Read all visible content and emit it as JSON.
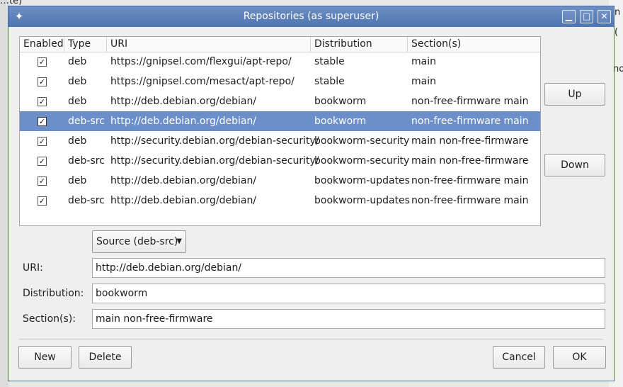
{
  "background": {
    "fragments": [
      "…te)",
      "n",
      "(",
      "no"
    ]
  },
  "titlebar": {
    "title": "Repositories (as superuser)",
    "buttons": [
      "minimize",
      "maximize",
      "close"
    ]
  },
  "table": {
    "columns": [
      "Enabled",
      "Type",
      "URI",
      "Distribution",
      "Section(s)"
    ],
    "selected_index": 3,
    "rows": [
      {
        "enabled": true,
        "type": "deb",
        "uri": "https://gnipsel.com/flexgui/apt-repo/",
        "distribution": "stable",
        "sections": "main"
      },
      {
        "enabled": true,
        "type": "deb",
        "uri": "https://gnipsel.com/mesact/apt-repo/",
        "distribution": "stable",
        "sections": "main"
      },
      {
        "enabled": true,
        "type": "deb",
        "uri": "http://deb.debian.org/debian/",
        "distribution": "bookworm",
        "sections": "non-free-firmware main"
      },
      {
        "enabled": true,
        "type": "deb-src",
        "uri": "http://deb.debian.org/debian/",
        "distribution": "bookworm",
        "sections": "non-free-firmware main"
      },
      {
        "enabled": true,
        "type": "deb",
        "uri": "http://security.debian.org/debian-security/",
        "distribution": "bookworm-security",
        "sections": "main non-free-firmware"
      },
      {
        "enabled": true,
        "type": "deb-src",
        "uri": "http://security.debian.org/debian-security/",
        "distribution": "bookworm-security",
        "sections": "main non-free-firmware"
      },
      {
        "enabled": true,
        "type": "deb",
        "uri": "http://deb.debian.org/debian/",
        "distribution": "bookworm-updates",
        "sections": "non-free-firmware main"
      },
      {
        "enabled": true,
        "type": "deb-src",
        "uri": "http://deb.debian.org/debian/",
        "distribution": "bookworm-updates",
        "sections": "non-free-firmware main"
      }
    ]
  },
  "side_buttons": {
    "up": "Up",
    "down": "Down"
  },
  "editor": {
    "source_type": "Source (deb-src)",
    "uri_label": "URI:",
    "uri_value": "http://deb.debian.org/debian/",
    "distribution_label": "Distribution:",
    "distribution_value": "bookworm",
    "sections_label": "Section(s):",
    "sections_value": "main non-free-firmware"
  },
  "footer": {
    "new": "New",
    "delete": "Delete",
    "cancel": "Cancel",
    "ok": "OK"
  },
  "colors": {
    "selection": "#6c8fca",
    "titlebar": "#5a7fbb"
  }
}
